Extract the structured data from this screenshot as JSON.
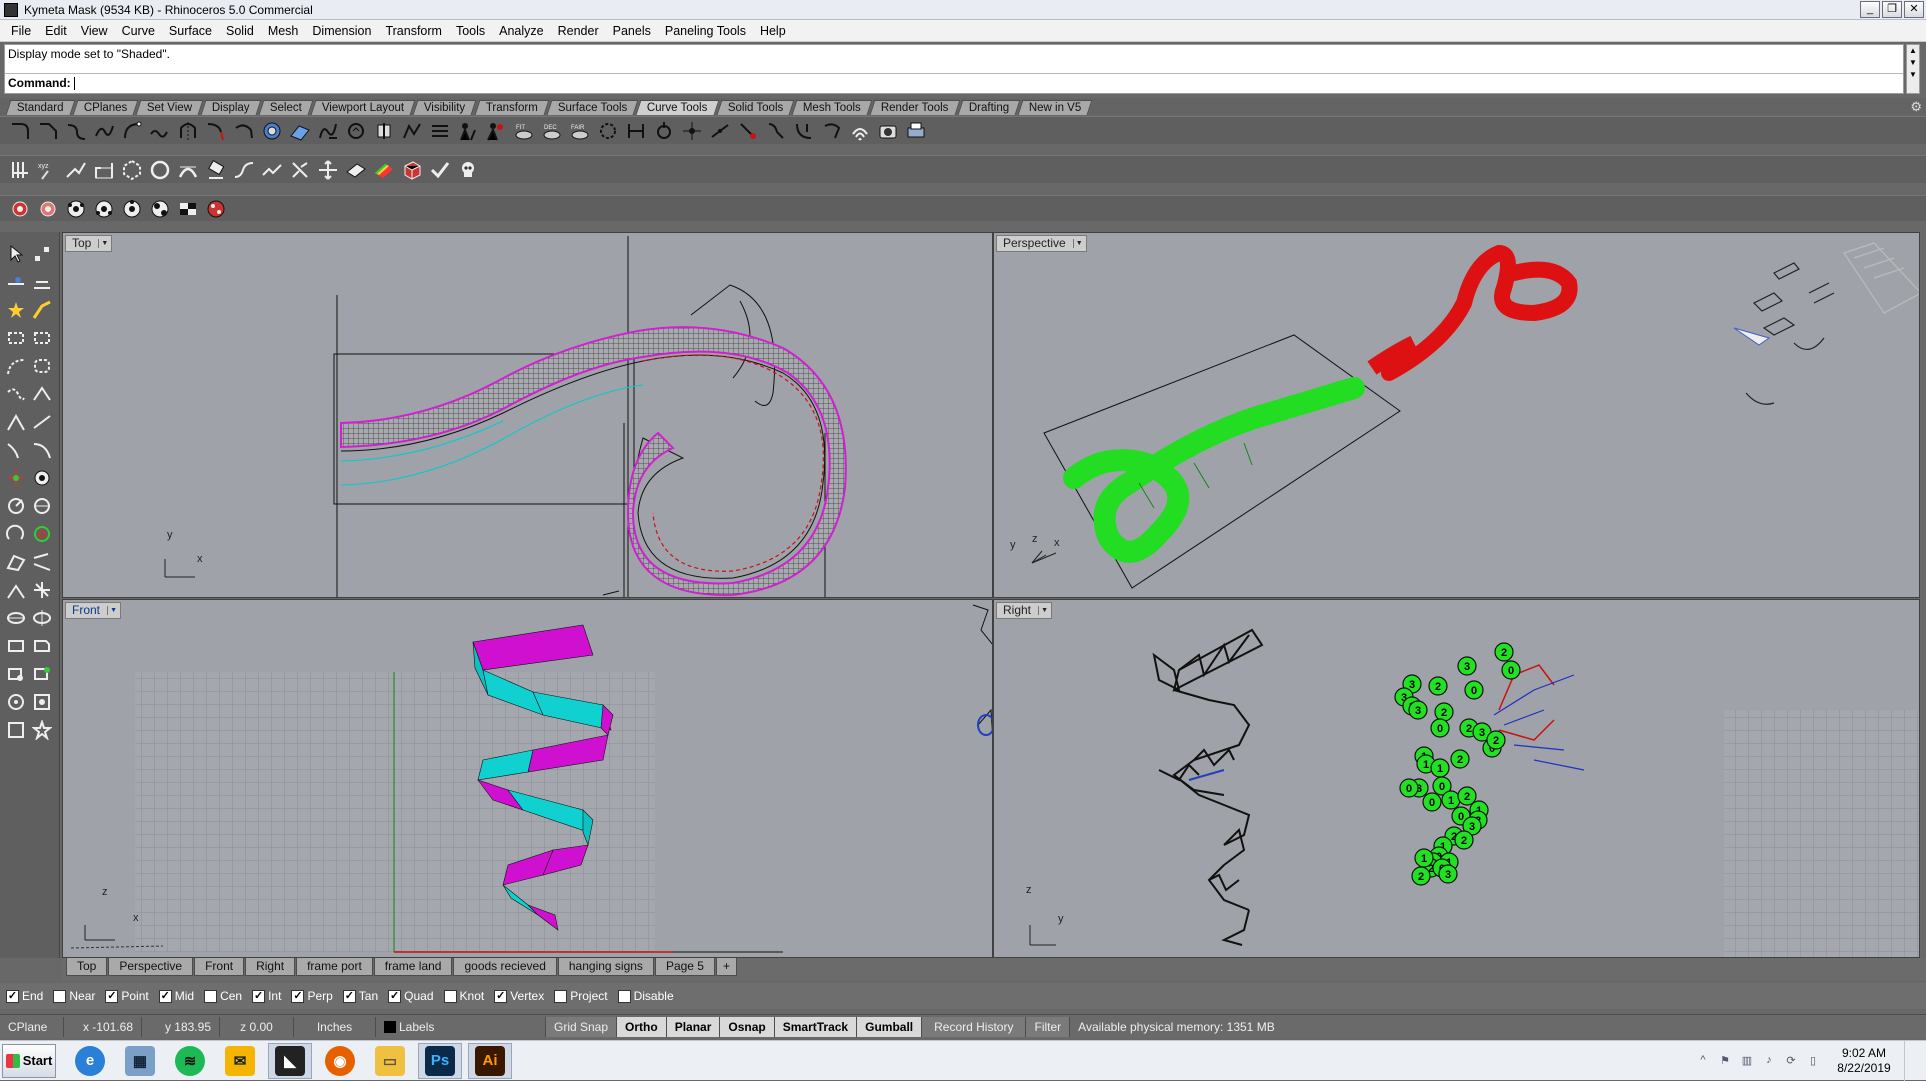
{
  "window": {
    "title": "Kymeta Mask (9534 KB) - Rhinoceros 5.0 Commercial",
    "buttons": [
      "_",
      "❐",
      "✕"
    ]
  },
  "menu": [
    "File",
    "Edit",
    "View",
    "Curve",
    "Surface",
    "Solid",
    "Mesh",
    "Dimension",
    "Transform",
    "Tools",
    "Analyze",
    "Render",
    "Panels",
    "Paneling Tools",
    "Help"
  ],
  "command": {
    "history": "Display mode set to \"Shaded\".",
    "prompt": "Command:"
  },
  "toolbar_tabs": [
    "Standard",
    "CPlanes",
    "Set View",
    "Display",
    "Select",
    "Viewport Layout",
    "Visibility",
    "Transform",
    "Surface Tools",
    "Curve Tools",
    "Solid Tools",
    "Mesh Tools",
    "Render Tools",
    "Drafting",
    "New in V5"
  ],
  "toolbar_active_tab": "Curve Tools",
  "toolbar_icon_labels": {
    "fit": "FIT",
    "dec": "DEC",
    "fair": "FAIR",
    "xyz": "xyz"
  },
  "viewports": {
    "top": {
      "label": "Top",
      "axis_x": "x",
      "axis_y": "y"
    },
    "perspective": {
      "label": "Perspective",
      "axis_x": "x",
      "axis_y": "y",
      "axis_z": "z"
    },
    "front": {
      "label": "Front",
      "axis_x": "x",
      "axis_z": "z"
    },
    "right": {
      "label": "Right",
      "axis_y": "y",
      "axis_z": "z"
    }
  },
  "point_labels": [
    "2",
    "3",
    "0",
    "3",
    "2",
    "3",
    "0",
    "2",
    "3",
    "2",
    "0",
    "1",
    "2",
    "0",
    "3",
    "2",
    "1",
    "2",
    "1",
    "3",
    "0",
    "0",
    "1",
    "0",
    "2",
    "1",
    "2",
    "0",
    "3",
    "2",
    "1",
    "0",
    "2",
    "2",
    "1",
    "2",
    "0",
    "3",
    "1",
    "2"
  ],
  "viewport_tabs": [
    "Top",
    "Perspective",
    "Front",
    "Right",
    "frame port",
    "frame land",
    "goods recieved",
    "hanging signs",
    "Page 5",
    "+"
  ],
  "osnaps": [
    {
      "label": "End",
      "checked": true
    },
    {
      "label": "Near",
      "checked": false
    },
    {
      "label": "Point",
      "checked": true
    },
    {
      "label": "Mid",
      "checked": true
    },
    {
      "label": "Cen",
      "checked": false
    },
    {
      "label": "Int",
      "checked": true
    },
    {
      "label": "Perp",
      "checked": true
    },
    {
      "label": "Tan",
      "checked": true
    },
    {
      "label": "Quad",
      "checked": true
    },
    {
      "label": "Knot",
      "checked": false
    },
    {
      "label": "Vertex",
      "checked": true
    },
    {
      "label": "Project",
      "checked": false
    },
    {
      "label": "Disable",
      "checked": false
    }
  ],
  "status": {
    "cplane": "CPlane",
    "x": "x -101.68",
    "y": "y 183.95",
    "z": "z 0.00",
    "units": "Inches",
    "layer": "Labels",
    "grid_snap": "Grid Snap",
    "ortho": "Ortho",
    "planar": "Planar",
    "osnap": "Osnap",
    "smarttrack": "SmartTrack",
    "gumball": "Gumball",
    "record_history": "Record History",
    "filter": "Filter",
    "memory": "Available physical memory: 1351 MB"
  },
  "taskbar": {
    "start": "Start",
    "apps": [
      "internet-explorer",
      "calculator",
      "spotify",
      "outlook",
      "rhino",
      "firefox",
      "file-explorer",
      "photoshop",
      "illustrator"
    ],
    "app_labels": {
      "photoshop": "Ps",
      "illustrator": "Ai"
    },
    "time": "9:02 AM",
    "date": "8/22/2019"
  }
}
